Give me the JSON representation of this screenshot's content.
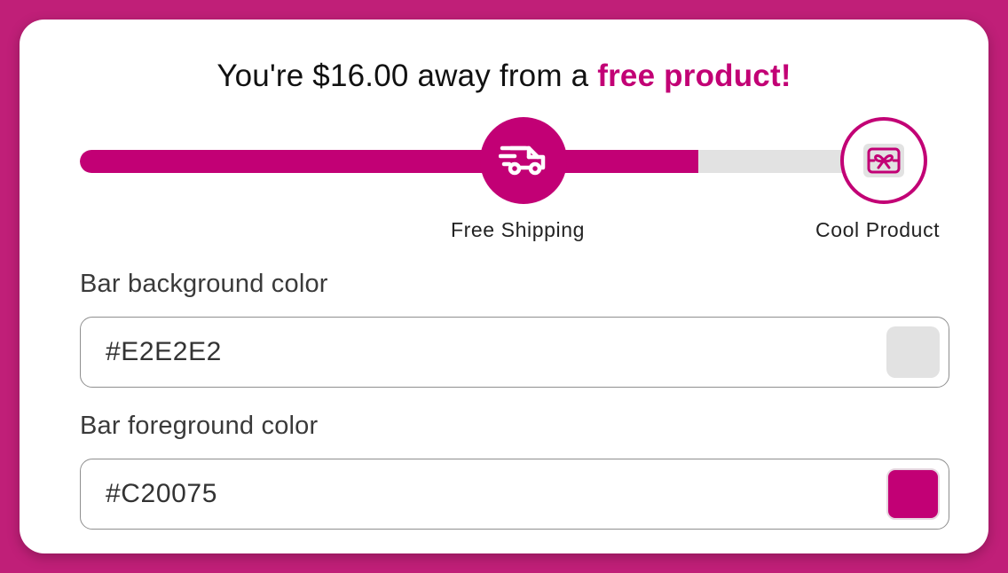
{
  "headline": {
    "prefix": "You're $16.00 away from a ",
    "highlight": "free product!"
  },
  "progress": {
    "fill_fraction": 0.742,
    "milestones": [
      {
        "label": "Free Shipping",
        "icon": "delivery-truck-icon",
        "reached": true
      },
      {
        "label": "Cool Product",
        "icon": "gift-icon",
        "reached": false
      }
    ]
  },
  "fields": {
    "background": {
      "label": "Bar background color",
      "value": "#E2E2E2"
    },
    "foreground": {
      "label": "Bar foreground color",
      "value": "#C20075"
    }
  },
  "colors": {
    "page_background": "#C01F78",
    "accent": "#C20075",
    "bar_background": "#E2E2E2"
  }
}
